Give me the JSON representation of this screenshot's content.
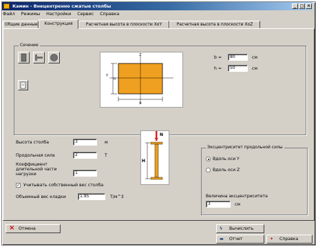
{
  "window": {
    "title": "Камин - Внецентренно сжатые столбы",
    "controls": {
      "minimize": "_",
      "maximize": "□",
      "close": "×"
    }
  },
  "menu": [
    "Файл",
    "Режимы",
    "Настройки",
    "Сервис",
    "Справка"
  ],
  "tabs": [
    {
      "label": "Общие данные",
      "active": false
    },
    {
      "label": "Конструкция",
      "active": true
    },
    {
      "label": "Расчетная высота в плоскости XoY",
      "active": false
    },
    {
      "label": "Расчетная высота в плоскости XoZ",
      "active": false
    }
  ],
  "section": {
    "group_title": "Сечение",
    "shapes": [
      "rectangle-section-icon",
      "i-beam-section-icon",
      "circle-section-icon"
    ],
    "edit_icon": "document-edit-icon",
    "b": {
      "label": "b =",
      "value": "80",
      "unit": "см"
    },
    "h": {
      "label": "h =",
      "value": "50",
      "unit": "см"
    },
    "diagram_labels": {
      "z": "Z",
      "y": "Y",
      "b_side": "b",
      "h_side": "h"
    },
    "fill_color": "#f0a020"
  },
  "params": {
    "height": {
      "label": "Высота столба",
      "value": "3",
      "unit": "м"
    },
    "force": {
      "label": "Продольная сила",
      "value": "2",
      "unit": "Т"
    },
    "coef": {
      "label": "Коэффициент длительной части нагрузки",
      "value": "1"
    },
    "self_weight": {
      "label": "Учитывать собственный вес столба",
      "checked": true,
      "mark": "✓"
    },
    "density": {
      "label": "Объемный вес кладки",
      "value": "1.95",
      "unit": "Т/м^3"
    }
  },
  "column_diagram": {
    "n_label": "N",
    "h_label": "H",
    "accent": "#e8a020"
  },
  "eccentricity": {
    "group_title": "Эксцентриситет продольной силы",
    "options": [
      {
        "label": "Вдоль оси Y",
        "selected": true
      },
      {
        "label": "Вдоль оси Z",
        "selected": false
      }
    ],
    "value_label": "Величина эксцентриситета",
    "value": "3",
    "unit": "см"
  },
  "buttons": {
    "cancel": {
      "label": "Отмена",
      "icon": "×",
      "icon_color": "#d00000"
    },
    "calc": {
      "label": "Вычислить",
      "icon": "ϟ",
      "icon_color": "#204080"
    },
    "report": {
      "label": "Отчет",
      "icon": "▬",
      "icon_color": "#204080"
    },
    "help": {
      "label": "Справка",
      "icon": "✦",
      "icon_color": "#c02020"
    }
  }
}
